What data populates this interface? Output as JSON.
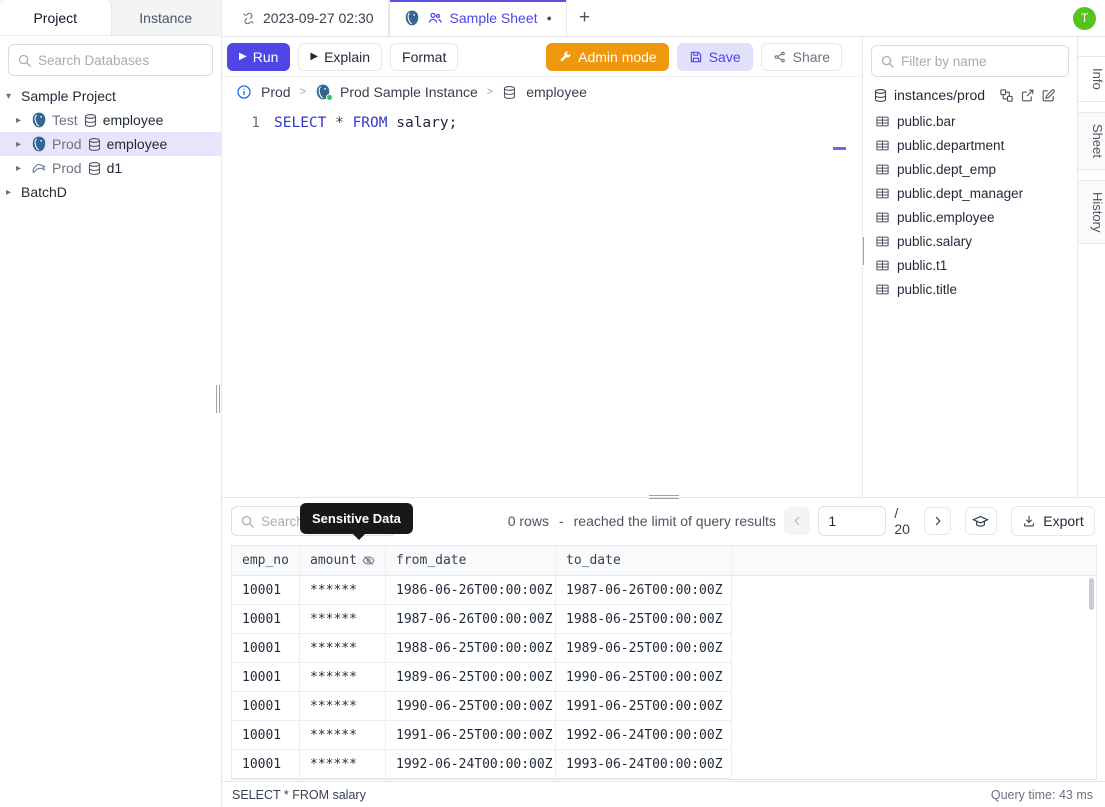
{
  "left_sidebar": {
    "tabs": [
      {
        "label": "Project",
        "active": true
      },
      {
        "label": "Instance",
        "active": false
      }
    ],
    "search_placeholder": "Search Databases",
    "tree": [
      {
        "kind": "group",
        "label": "Sample Project",
        "expanded": true
      },
      {
        "kind": "database",
        "engine": "postgres",
        "env": "Test",
        "name": "employee",
        "selected": false
      },
      {
        "kind": "database",
        "engine": "postgres",
        "env": "Prod",
        "name": "employee",
        "selected": true
      },
      {
        "kind": "database",
        "engine": "mysql",
        "env": "Prod",
        "name": "d1",
        "selected": false
      },
      {
        "kind": "group",
        "label": "BatchD",
        "expanded": false
      }
    ]
  },
  "tab_bar": {
    "tabs": [
      {
        "label": "2023-09-27 02:30",
        "active": false
      },
      {
        "label": "Sample Sheet",
        "active": true,
        "shared": true,
        "unsaved": true
      }
    ],
    "new_tab_label": "+",
    "avatar_initial": "T"
  },
  "toolbar": {
    "run_label": "Run",
    "explain_label": "Explain",
    "format_label": "Format",
    "admin_label": "Admin mode",
    "save_label": "Save",
    "share_label": "Share"
  },
  "breadcrumb": {
    "environment": "Prod",
    "instance": "Prod Sample Instance",
    "database": "employee"
  },
  "editor": {
    "line_number": "1",
    "sql_tokens": [
      {
        "text": "SELECT ",
        "type": "keyword"
      },
      {
        "text": "* ",
        "type": "operator"
      },
      {
        "text": "FROM ",
        "type": "keyword"
      },
      {
        "text": "salary;",
        "type": "text"
      }
    ]
  },
  "schema_sidebar": {
    "filter_placeholder": "Filter by name",
    "header": "instances/prod",
    "tables": [
      "public.bar",
      "public.department",
      "public.dept_emp",
      "public.dept_manager",
      "public.employee",
      "public.salary",
      "public.t1",
      "public.title"
    ]
  },
  "right_tabs": [
    {
      "label": "Info",
      "active": true
    },
    {
      "label": "Sheet",
      "active": false
    },
    {
      "label": "History",
      "active": false
    }
  ],
  "results": {
    "search_placeholder": "Search",
    "tooltip": "Sensitive Data",
    "row_count": "0 rows",
    "separator": "-",
    "limit_note": "reached the limit of query results",
    "pagination": {
      "page": "1",
      "total": "/ 20"
    },
    "export_label": "Export",
    "table": {
      "columns": [
        "emp_no",
        "amount",
        "from_date",
        "to_date"
      ],
      "masked_column": "amount",
      "rows": [
        [
          "10001",
          "******",
          "1986-06-26T00:00:00Z",
          "1987-06-26T00:00:00Z"
        ],
        [
          "10001",
          "******",
          "1987-06-26T00:00:00Z",
          "1988-06-25T00:00:00Z"
        ],
        [
          "10001",
          "******",
          "1988-06-25T00:00:00Z",
          "1989-06-25T00:00:00Z"
        ],
        [
          "10001",
          "******",
          "1989-06-25T00:00:00Z",
          "1990-06-25T00:00:00Z"
        ],
        [
          "10001",
          "******",
          "1990-06-25T00:00:00Z",
          "1991-06-25T00:00:00Z"
        ],
        [
          "10001",
          "******",
          "1991-06-25T00:00:00Z",
          "1992-06-24T00:00:00Z"
        ],
        [
          "10001",
          "******",
          "1992-06-24T00:00:00Z",
          "1993-06-24T00:00:00Z"
        ]
      ]
    },
    "status_sql": "SELECT * FROM salary",
    "query_time": "Query time: 43 ms"
  },
  "icons": {
    "play": "▶",
    "caret_down": "▾",
    "caret_right": "▸",
    "unsaved_dot": "●",
    "new_tab": "+"
  },
  "colors": {
    "accent_indigo": "#4f46e5",
    "admin_orange": "#f0980b",
    "save_bg": "#e2e0fb",
    "selected_row_bg": "#e7e4fb",
    "avatar_green": "#55c41e",
    "tooltip_bg": "#18181b",
    "border": "#e5e7eb",
    "status_green": "#22c55e"
  }
}
